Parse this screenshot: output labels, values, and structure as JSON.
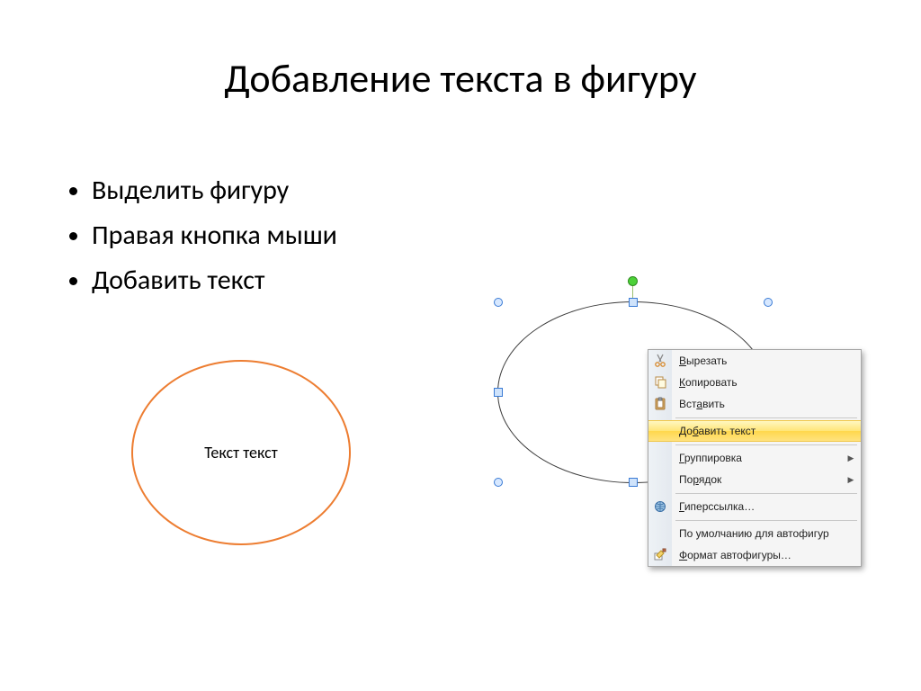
{
  "title": "Добавление текста в фигуру",
  "bullets": [
    "Выделить фигуру",
    "Правая кнопка мыши",
    "Добавить текст"
  ],
  "orange_ellipse_text": "Текст текст",
  "context_menu": {
    "items": [
      {
        "icon": "cut-icon",
        "label": "Вырезать",
        "underline_index": 0,
        "submenu": false,
        "highlighted": false
      },
      {
        "icon": "copy-icon",
        "label": "Копировать",
        "underline_index": 0,
        "submenu": false,
        "highlighted": false
      },
      {
        "icon": "paste-icon",
        "label": "Вставить",
        "underline_index": 3,
        "submenu": false,
        "highlighted": false
      },
      {
        "separator": true
      },
      {
        "icon": null,
        "label": "Добавить текст",
        "underline_index": 2,
        "submenu": false,
        "highlighted": true
      },
      {
        "separator": true
      },
      {
        "icon": null,
        "label": "Группировка",
        "underline_index": 0,
        "submenu": true,
        "highlighted": false
      },
      {
        "icon": null,
        "label": "Порядок",
        "underline_index": 2,
        "submenu": true,
        "highlighted": false
      },
      {
        "separator": true
      },
      {
        "icon": "hyperlink-icon",
        "label": "Гиперссылка…",
        "underline_index": 0,
        "submenu": false,
        "highlighted": false
      },
      {
        "separator": true
      },
      {
        "icon": null,
        "label": "По умолчанию для автофигур",
        "underline_index": null,
        "submenu": false,
        "highlighted": false
      },
      {
        "icon": "format-icon",
        "label": "Формат автофигуры…",
        "underline_index": 0,
        "submenu": false,
        "highlighted": false
      }
    ]
  },
  "colors": {
    "orange": "#ed7d31",
    "selection_handle": "#3a7bd5",
    "menu_highlight": "#ffe27f"
  }
}
